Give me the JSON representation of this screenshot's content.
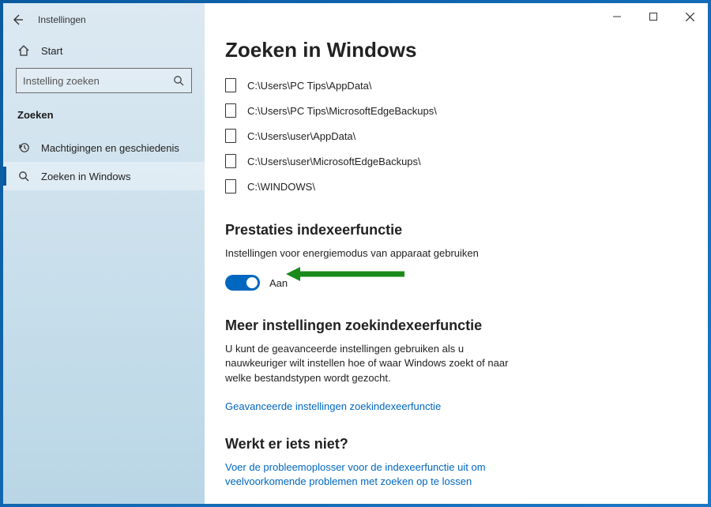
{
  "app": {
    "title": "Instellingen"
  },
  "sidebar": {
    "home": "Start",
    "search_placeholder": "Instelling zoeken",
    "section_label": "Zoeken",
    "items": [
      {
        "label": "Machtigingen en geschiedenis"
      },
      {
        "label": "Zoeken in Windows"
      }
    ]
  },
  "main": {
    "title": "Zoeken in Windows",
    "folders": [
      "C:\\Users\\PC Tips\\AppData\\",
      "C:\\Users\\PC Tips\\MicrosoftEdgeBackups\\",
      "C:\\Users\\user\\AppData\\",
      "C:\\Users\\user\\MicrosoftEdgeBackups\\",
      "C:\\WINDOWS\\"
    ],
    "perf_heading": "Prestaties indexeerfunctie",
    "perf_sub": "Instellingen voor energiemodus van apparaat gebruiken",
    "toggle_label": "Aan",
    "more_heading": "Meer instellingen zoekindexeerfunctie",
    "more_text": "U kunt de geavanceerde instellingen gebruiken als u nauwkeuriger wilt instellen hoe of waar Windows zoekt of naar welke bestandstypen wordt gezocht.",
    "more_link": "Geavanceerde instellingen zoekindexeerfunctie",
    "trouble_heading": "Werkt er iets niet?",
    "trouble_link": "Voer de probleemoplosser voor de indexeerfunctie uit om veelvoorkomende problemen met zoeken op te lossen"
  }
}
